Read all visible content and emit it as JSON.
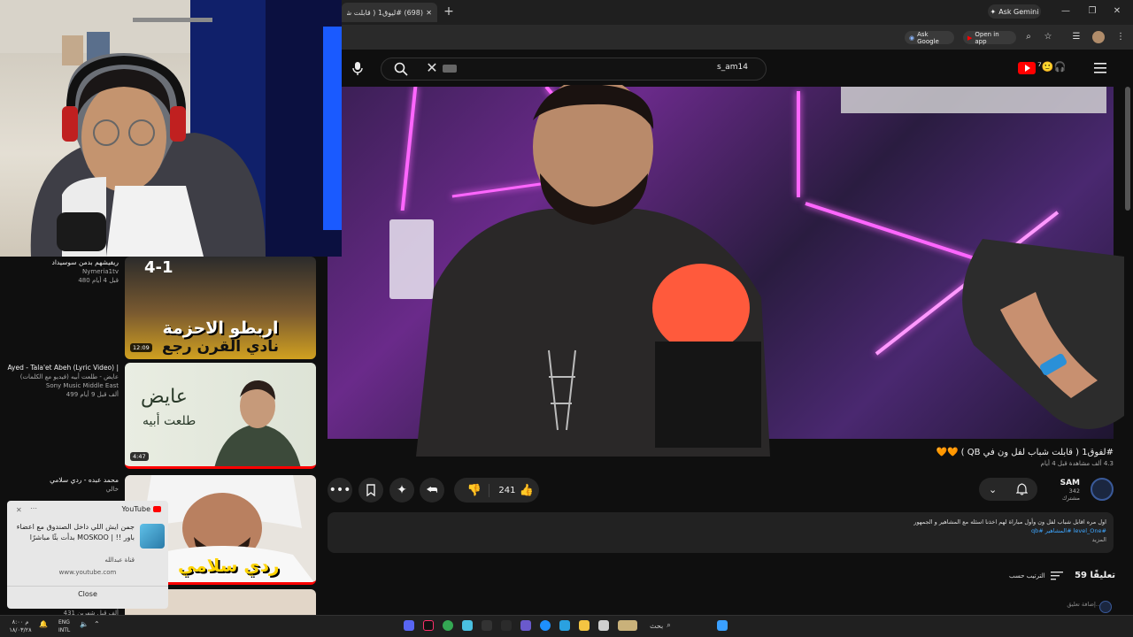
{
  "browser": {
    "tab_title": "(698) #ليوق1 ( قابلت شباب لفل ون",
    "ask_gemini": "Ask Gemini",
    "ask_google": "Ask Google",
    "open_in_app": "Open in app"
  },
  "youtube": {
    "search_query": "s_am14"
  },
  "video": {
    "title": "#لفوق1 ( قابلت شباب لفل ون في QB ) 🧡🧡",
    "meta": "4.3 ألف مشاهدة قبل 4 أيام",
    "likes": "241",
    "channel_name": "SAM",
    "subscribers": "342 مشترك",
    "description_line1": "اول مره اقابل شباب لفل ون وأول مباراة لهم اخذنا اسئله مع المشاهير و الجمهور",
    "description_tags": "#level_One #المشاهير #qb",
    "description_more": "المزيد",
    "comments_count": "59 تعليقًا",
    "sort_by": "الترتيب حسب",
    "add_comment": "إضافة تعليق..."
  },
  "sidebar": {
    "items": [
      {
        "title": "ريفيشهم بدمن سوسيداد",
        "channel": "Nymeria1tv",
        "meta": "480 قبل 4 أيام",
        "duration": "12:09",
        "thumb_text": "اربطو الاحزمة",
        "thumb_sub": "نادي القرن رجع",
        "score": "4-1"
      },
      {
        "title": "Ayed - Tala'et Abeh (Lyric Video) |",
        "subtitle": "عايض - طلعت أبيه (فيديو مع الكلمات)",
        "channel": "Sony Music Middle East",
        "meta": "499 ألف قبل 9 أيام",
        "duration": "4:47",
        "thumb_text": "عايض",
        "thumb_sub": "طلعت أبيه"
      },
      {
        "title": "محمد عبده - ردي سلامي",
        "channel": "خالي",
        "thumb_text": "ردي سلامي"
      },
      {
        "meta": "431 ألف قبل شهرين"
      }
    ]
  },
  "notification": {
    "app": "YouTube",
    "text": "جمن ايش اللي داخل الصندوق مع اعضاء باور !! | MOSKOO بدأت بثًا مباشرًا",
    "subtext": "قناة عبدالله",
    "source": "www.youtube.com",
    "close": "Close"
  },
  "taskbar": {
    "time": "م ٨:٠٠",
    "date": "١٨/٠٣/٢٨",
    "lang": "ENG",
    "lang2": "INTL",
    "search": "بحث"
  },
  "colors": {
    "background": "#0f0f0f",
    "accent": "#ff0000",
    "link": "#3ea6ff"
  }
}
